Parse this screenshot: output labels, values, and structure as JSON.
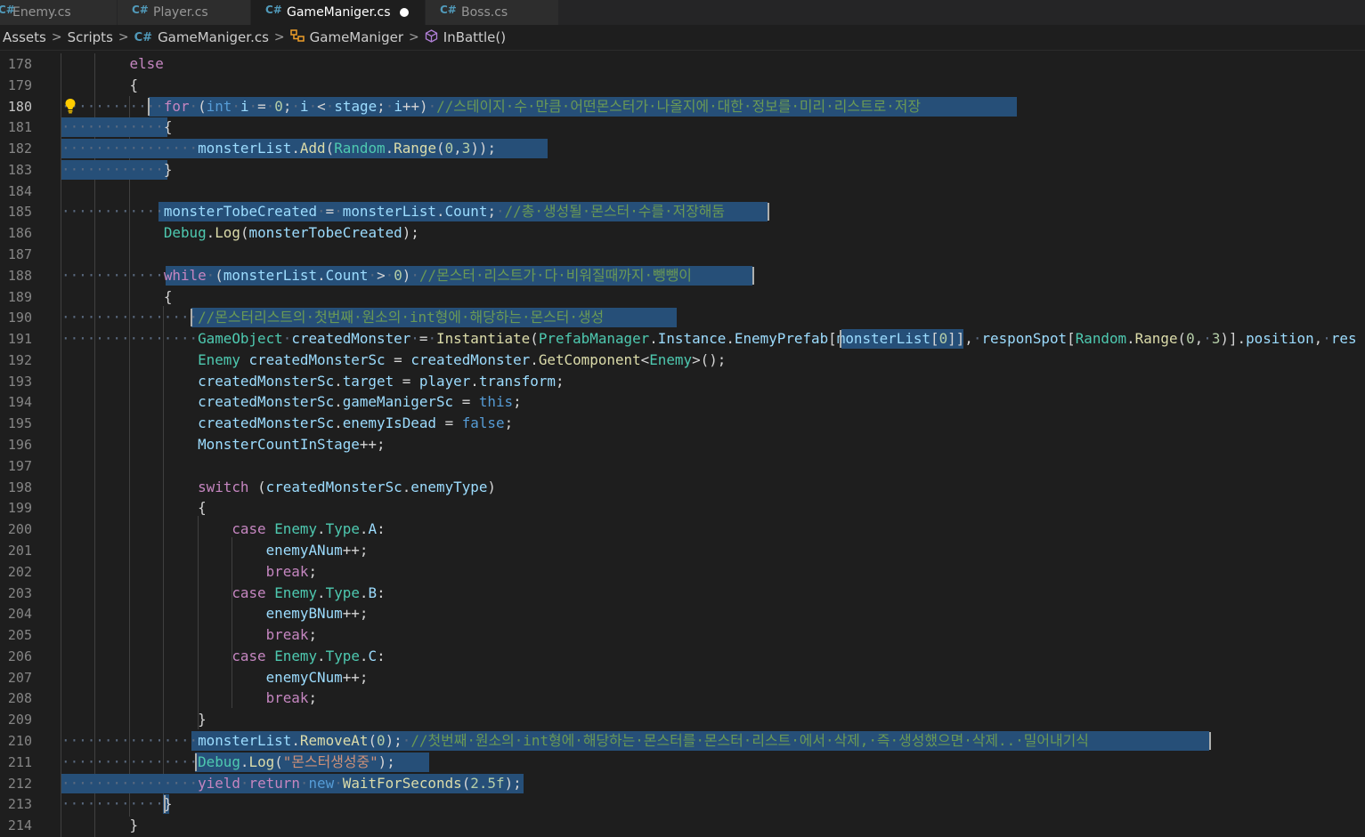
{
  "tabs": [
    {
      "label": "Enemy.cs",
      "active": false
    },
    {
      "label": "Player.cs",
      "active": false
    },
    {
      "label": "GameManiger.cs",
      "active": true,
      "dirty": true
    },
    {
      "label": "Boss.cs",
      "active": false
    }
  ],
  "breadcrumb": {
    "assets": "Assets",
    "scripts": "Scripts",
    "file": "GameManiger.cs",
    "class": "GameManiger",
    "method": "InBattle()"
  },
  "icons": {
    "csharp_file": "csharp-file-icon",
    "class": "class-icon",
    "method": "method-icon",
    "lightbulb": "lightbulb-icon"
  },
  "colors": {
    "background": "#1e1e1e",
    "selection": "#264f78",
    "keyword": "#c586c0",
    "type": "#4ec9b0",
    "comment": "#6a9955"
  },
  "code": {
    "current_line": 180,
    "lines": [
      {
        "n": "178",
        "t": "        else"
      },
      {
        "n": "179",
        "t": "        {"
      },
      {
        "n": "180",
        "t": "            for (int i = 0; i < stage; i++) //스테이지 수 만큼 어떤몬스터가 나올지에 대한 정보를 미리 리스트로 저장"
      },
      {
        "n": "181",
        "t": "            {"
      },
      {
        "n": "182",
        "t": "                monsterList.Add(Random.Range(0,3));"
      },
      {
        "n": "183",
        "t": "            }"
      },
      {
        "n": "184",
        "t": ""
      },
      {
        "n": "185",
        "t": "            monsterTobeCreated = monsterList.Count; //총 생성될 몬스터 수를 저장해둠"
      },
      {
        "n": "186",
        "t": "            Debug.Log(monsterTobeCreated);"
      },
      {
        "n": "187",
        "t": ""
      },
      {
        "n": "188",
        "t": "            while (monsterList.Count > 0) //몬스터 리스트가 다 비워질때까지 뺑뺑이"
      },
      {
        "n": "189",
        "t": "            {"
      },
      {
        "n": "190",
        "t": "                //몬스터리스트의 첫번째 원소의 int형에 해당하는 몬스터 생성"
      },
      {
        "n": "191",
        "t": "                GameObject createdMonster = Instantiate(PrefabManager.Instance.EnemyPrefab[monsterList[0]], responSpot[Random.Range(0, 3)].position, res"
      },
      {
        "n": "192",
        "t": "                Enemy createdMonsterSc = createdMonster.GetComponent<Enemy>();"
      },
      {
        "n": "193",
        "t": "                createdMonsterSc.target = player.transform;"
      },
      {
        "n": "194",
        "t": "                createdMonsterSc.gameManigerSc = this;"
      },
      {
        "n": "195",
        "t": "                createdMonsterSc.enemyIsDead = false;"
      },
      {
        "n": "196",
        "t": "                MonsterCountInStage++;"
      },
      {
        "n": "197",
        "t": ""
      },
      {
        "n": "198",
        "t": "                switch (createdMonsterSc.enemyType)"
      },
      {
        "n": "199",
        "t": "                {"
      },
      {
        "n": "200",
        "t": "                    case Enemy.Type.A:"
      },
      {
        "n": "201",
        "t": "                        enemyANum++;"
      },
      {
        "n": "202",
        "t": "                        break;"
      },
      {
        "n": "203",
        "t": "                    case Enemy.Type.B:"
      },
      {
        "n": "204",
        "t": "                        enemyBNum++;"
      },
      {
        "n": "205",
        "t": "                        break;"
      },
      {
        "n": "206",
        "t": "                    case Enemy.Type.C:"
      },
      {
        "n": "207",
        "t": "                        enemyCNum++;"
      },
      {
        "n": "208",
        "t": "                        break;"
      },
      {
        "n": "209",
        "t": "                }"
      },
      {
        "n": "210",
        "t": "                monsterList.RemoveAt(0); //첫번째 원소의 int형에 해당하는 몬스터를 몬스터 리스트 에서 삭제, 즉 생성했으면 삭제.. 밀어내기식"
      },
      {
        "n": "211",
        "t": "                Debug.Log(\"몬스터생성중\");"
      },
      {
        "n": "212",
        "t": "                yield return new WaitForSeconds(2.5f);"
      },
      {
        "n": "213",
        "t": "            }"
      },
      {
        "n": "214",
        "t": "        }"
      }
    ]
  }
}
